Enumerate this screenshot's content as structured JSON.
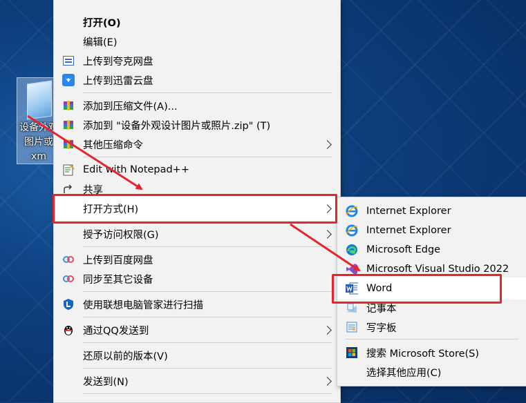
{
  "desktop_icon": {
    "label_lines": [
      "设备外观",
      "图片或",
      "xm"
    ]
  },
  "context_menu": {
    "items": [
      {
        "label": "打开(O)"
      },
      {
        "label": "编辑(E)"
      },
      {
        "label": "上传到夸克网盘"
      },
      {
        "label": "上传到迅雷云盘"
      },
      {
        "label": "添加到压缩文件(A)..."
      },
      {
        "label": "添加到 \"设备外观设计图片或照片.zip\" (T)"
      },
      {
        "label": "其他压缩命令"
      },
      {
        "label": "Edit with Notepad++"
      },
      {
        "label": "共享"
      },
      {
        "label": "打开方式(H)"
      },
      {
        "label": "授予访问权限(G)"
      },
      {
        "label": "上传到百度网盘"
      },
      {
        "label": "同步至其它设备"
      },
      {
        "label": "使用联想电脑管家进行扫描"
      },
      {
        "label": "通过QQ发送到"
      },
      {
        "label": "还原以前的版本(V)"
      },
      {
        "label": "发送到(N)"
      }
    ]
  },
  "open_with_menu": {
    "items": [
      {
        "label": "Internet Explorer"
      },
      {
        "label": "Internet Explorer"
      },
      {
        "label": "Microsoft Edge"
      },
      {
        "label": "Microsoft Visual Studio 2022"
      },
      {
        "label": "Word"
      },
      {
        "label": "记事本"
      },
      {
        "label": "写字板"
      },
      {
        "label": "搜索 Microsoft Store(S)"
      },
      {
        "label": "选择其他应用(C)"
      }
    ]
  },
  "colors": {
    "highlight_box": "#e5242b",
    "arrow": "#e5242b",
    "menu_bg": "#f2f2f2"
  }
}
